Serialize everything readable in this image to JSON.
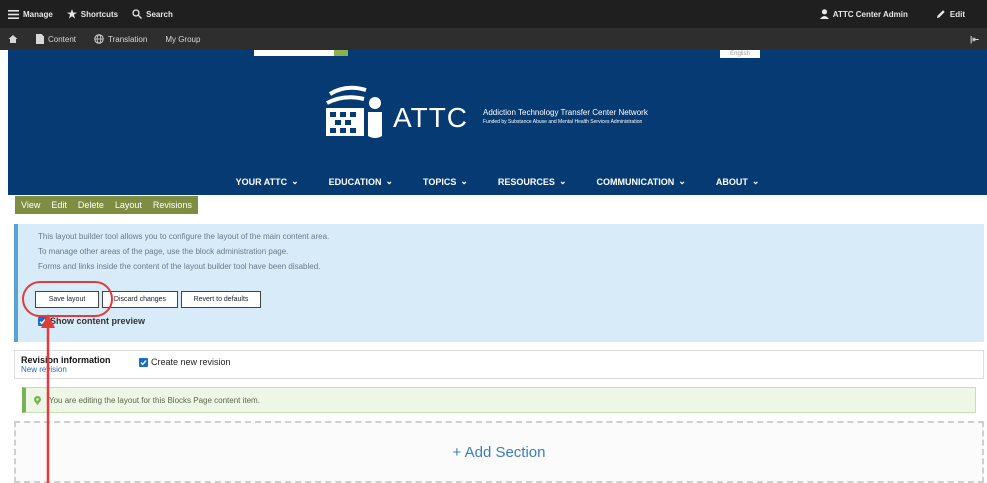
{
  "admin_toolbar": {
    "manage": "Manage",
    "shortcuts": "Shortcuts",
    "search": "Search",
    "user": "ATTC Center Admin",
    "edit": "Edit"
  },
  "admin_subbar": {
    "content": "Content",
    "translation": "Translation",
    "my_group": "My Group"
  },
  "header": {
    "language": "English",
    "brand": "ATTC",
    "network_name": "Addiction Technology Transfer Center Network",
    "funded_by": "Funded by Substance Abuse and Mental Health Services Administration",
    "nav": [
      "YOUR ATTC",
      "EDUCATION",
      "TOPICS",
      "RESOURCES",
      "COMMUNICATION",
      "ABOUT"
    ]
  },
  "tabs": [
    "View",
    "Edit",
    "Delete",
    "Layout",
    "Revisions"
  ],
  "layout_builder": {
    "messages": [
      "This layout builder tool allows you to configure the layout of the main content area.",
      "To manage other areas of the page, use the block administration page.",
      "Forms and links inside the content of the layout builder tool have been disabled."
    ],
    "save_label": "Save layout",
    "discard_label": "Discard changes",
    "revert_label": "Revert to defaults",
    "preview_label": "Show content preview"
  },
  "revision": {
    "title": "Revision information",
    "link": "New revision",
    "create_label": "Create new revision"
  },
  "status_message": "You are editing the layout for this Blocks Page content item.",
  "add_section_label": "+ Add Section",
  "colors": {
    "admin_bar": "#1f1f1f",
    "header_blue": "#063a73",
    "tabs_green": "#7f8d42",
    "info_blue": "#d7ebf8",
    "highlight_red": "#e33b3b",
    "link_blue": "#3a7dbf"
  }
}
